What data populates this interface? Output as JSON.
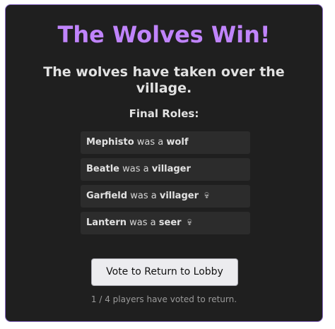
{
  "result": {
    "title": "The Wolves Win!",
    "subtitle": "The wolves have taken over the village."
  },
  "roles": {
    "heading": "Final Roles:",
    "connector": "was a",
    "items": [
      {
        "player": "Mephisto",
        "role": "wolf",
        "dead": false,
        "dead_icon": ""
      },
      {
        "player": "Beatle",
        "role": "villager",
        "dead": false,
        "dead_icon": ""
      },
      {
        "player": "Garfield",
        "role": "villager",
        "dead": true,
        "dead_icon": "skull-icon"
      },
      {
        "player": "Lantern",
        "role": "seer",
        "dead": true,
        "dead_icon": "skull-icon"
      }
    ]
  },
  "vote": {
    "button_label": "Vote to Return to Lobby",
    "status": "1 / 4 players have voted to return."
  },
  "colors": {
    "background": "#1f1f1f",
    "border_accent": "#8a6cc6",
    "title_purple": "#c084fc",
    "text": "#e2e2e2",
    "muted": "#9a9a9a"
  }
}
